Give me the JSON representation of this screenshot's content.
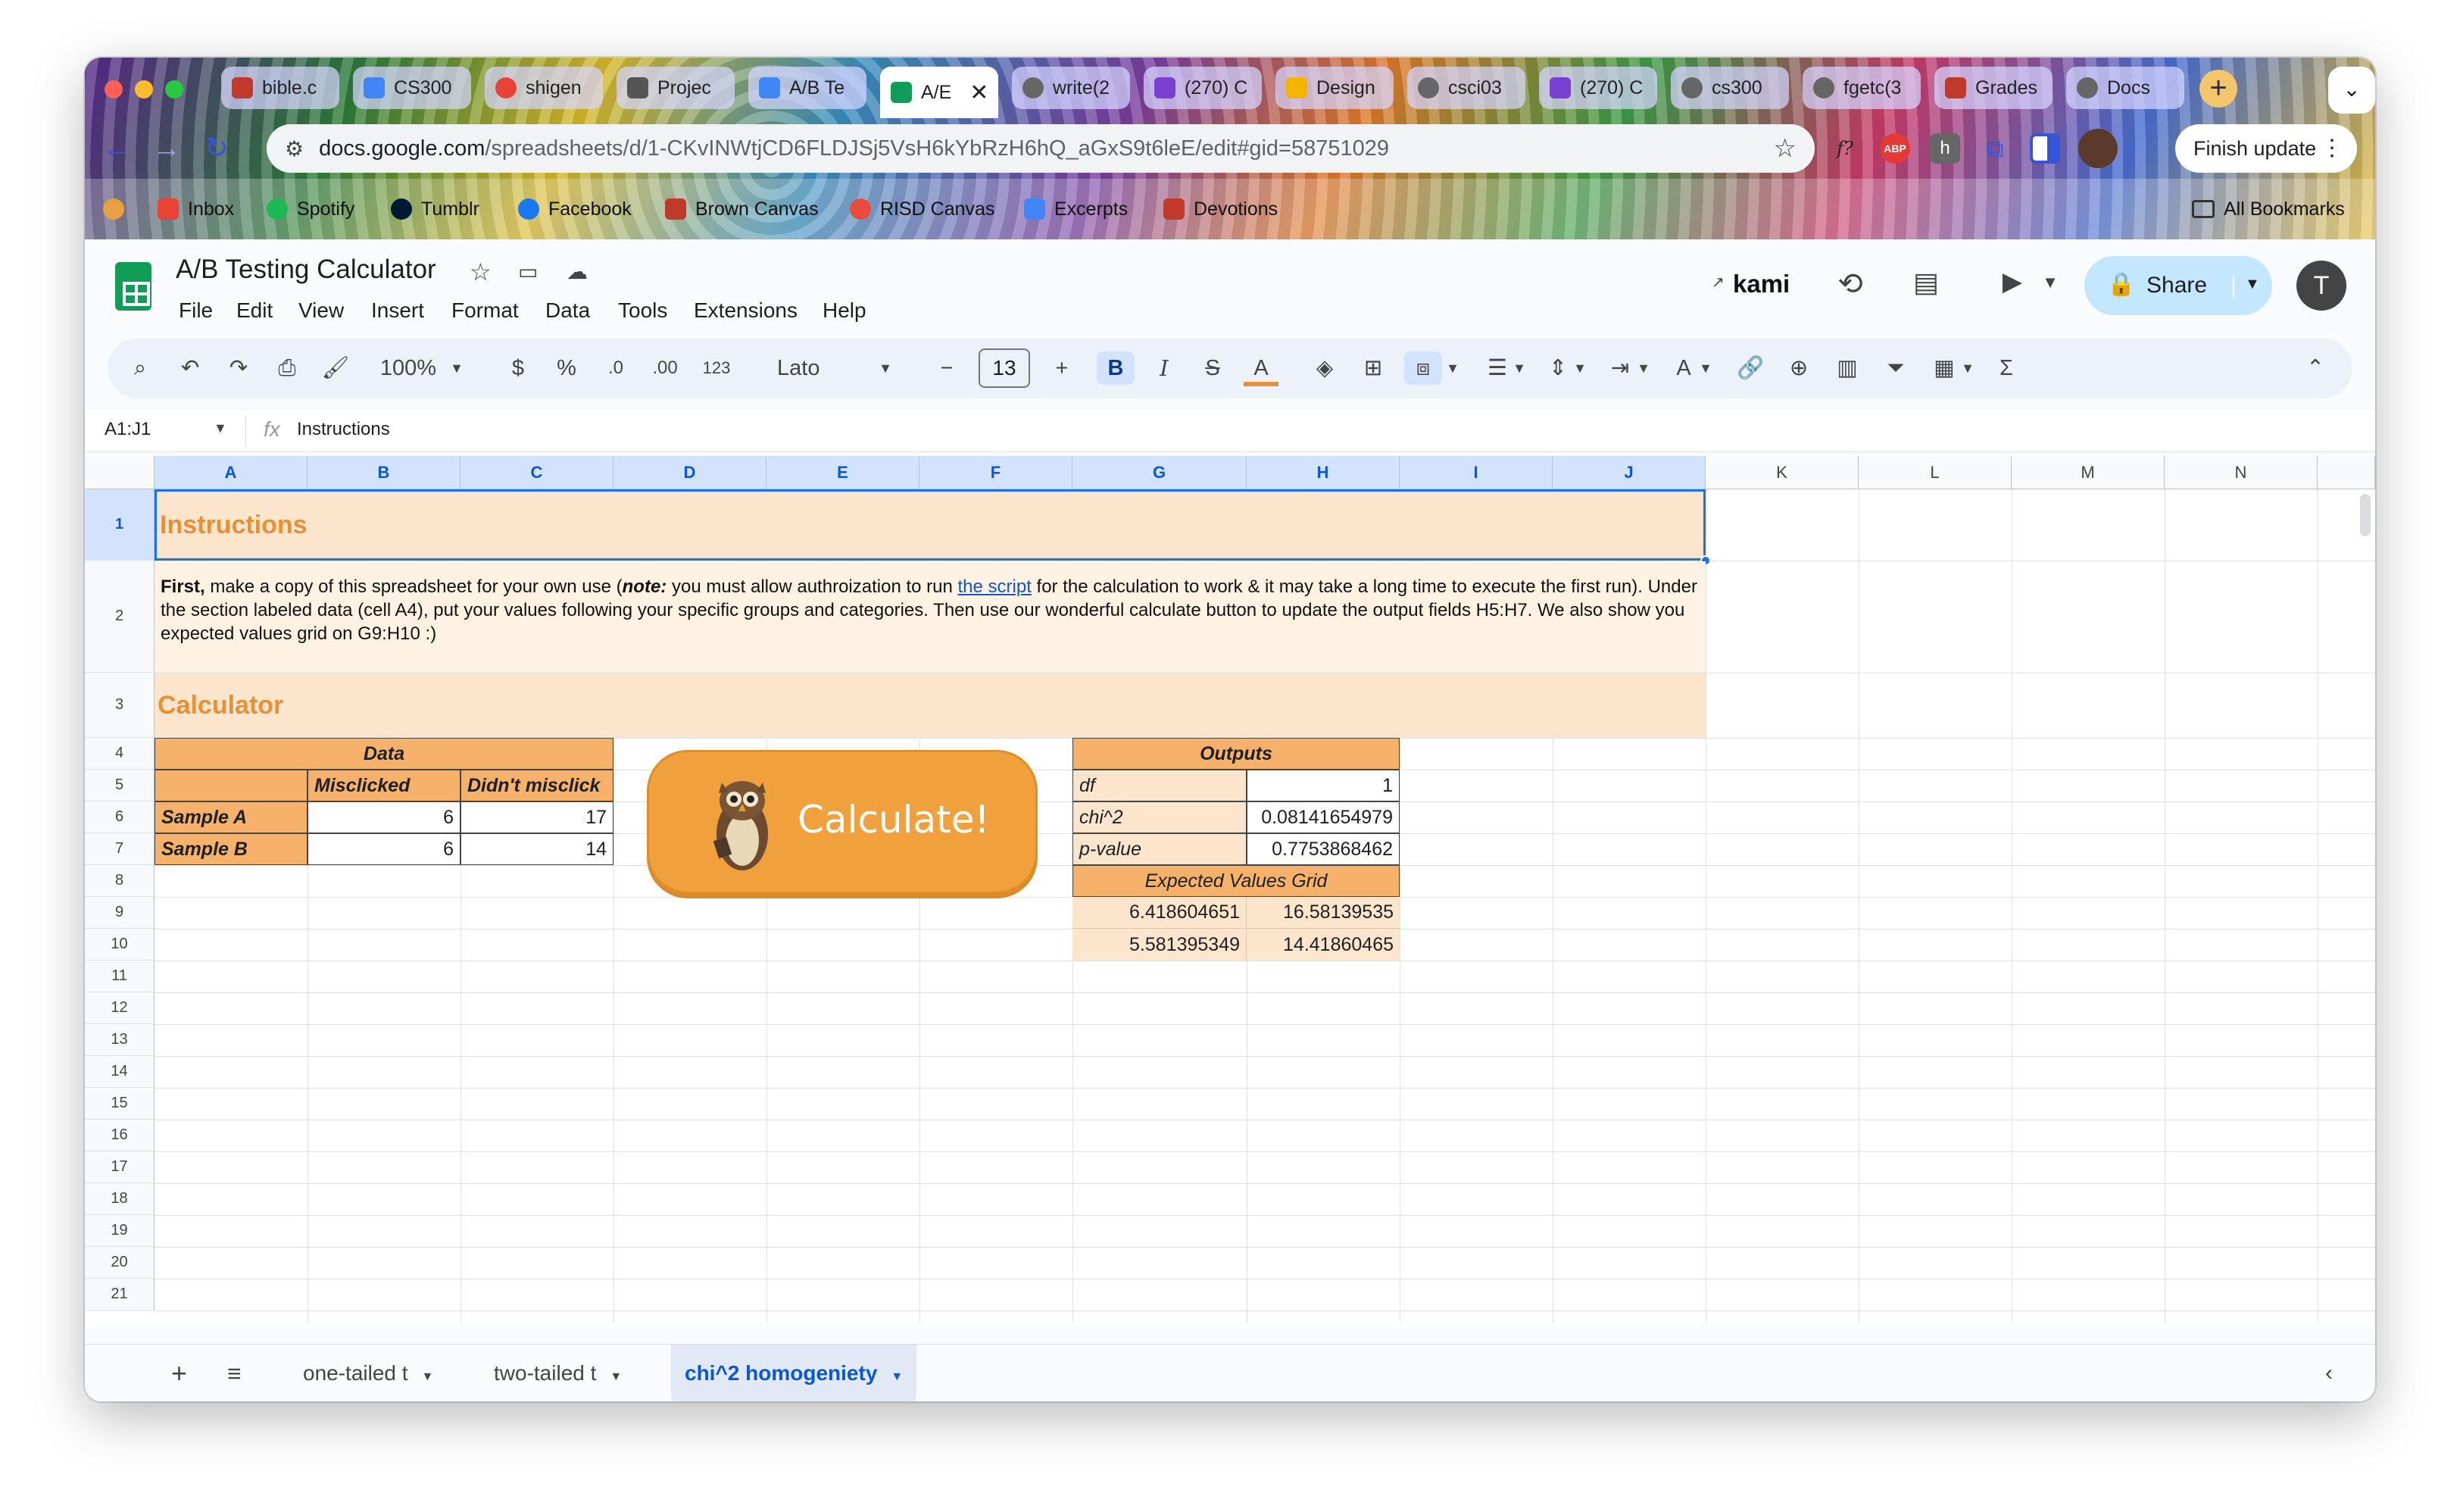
{
  "browser": {
    "tabs": [
      {
        "label": "bible.c",
        "color": "#c0392b"
      },
      {
        "label": "CS300",
        "color": "#4285f4"
      },
      {
        "label": "shigen",
        "color": "#ea4335"
      },
      {
        "label": "Projec",
        "color": "#555555"
      },
      {
        "label": "A/B Te",
        "color": "#4285f4"
      },
      {
        "label": "A/E",
        "color": "#0f9d58"
      },
      {
        "label": "write(2",
        "color": "#666666"
      },
      {
        "label": "(270) C",
        "color": "#7b3fd1"
      },
      {
        "label": "Design",
        "color": "#f4b400"
      },
      {
        "label": "csci03",
        "color": "#666666"
      },
      {
        "label": "(270) C",
        "color": "#7b3fd1"
      },
      {
        "label": "cs300",
        "color": "#666666"
      },
      {
        "label": "fgetc(3",
        "color": "#666666"
      },
      {
        "label": "Grades",
        "color": "#c0392b"
      },
      {
        "label": "Docs",
        "color": "#666666"
      }
    ],
    "new_tab": "+",
    "url_host": "docs.google.com",
    "url_path": "/spreadsheets/d/1-CKvINWtjCD6FLDJSj5VsH6kYbRzH6hQ_aGxS9t6leE/edit#gid=58751029",
    "finish_update": "Finish update",
    "extension_f": "f?",
    "extension_abp": "ABP",
    "bookmarks": [
      {
        "label": "Inbox",
        "color": "#ea4335"
      },
      {
        "label": "Spotify",
        "color": "#1db954"
      },
      {
        "label": "Tumblr",
        "color": "#001935"
      },
      {
        "label": "Facebook",
        "color": "#1877f2"
      },
      {
        "label": "Brown Canvas",
        "color": "#c0392b"
      },
      {
        "label": "RISD Canvas",
        "color": "#e74c3c"
      },
      {
        "label": "Excerpts",
        "color": "#4285f4"
      },
      {
        "label": "Devotions",
        "color": "#c0392b"
      }
    ],
    "all_bookmarks": "All Bookmarks"
  },
  "doc": {
    "title": "A/B Testing Calculator",
    "menus": [
      "File",
      "Edit",
      "View",
      "Insert",
      "Format",
      "Data",
      "Tools",
      "Extensions",
      "Help"
    ],
    "kami": "kami",
    "share": "Share",
    "avatar": "T"
  },
  "toolbar": {
    "zoom": "100%",
    "currency": "$",
    "percent": "%",
    "dec_decrease": ".0",
    "dec_increase": ".00",
    "number_format": "123",
    "font": "Lato",
    "font_size": "13",
    "bold": "B",
    "italic": "I",
    "strike": "S",
    "text_color": "A"
  },
  "formula_bar": {
    "name_box": "A1:J1",
    "fx": "fx",
    "value": "Instructions"
  },
  "sheet": {
    "columns": [
      "A",
      "B",
      "C",
      "D",
      "E",
      "F",
      "G",
      "H",
      "I",
      "J",
      "K",
      "L",
      "M",
      "N"
    ],
    "rows": [
      "1",
      "2",
      "3",
      "4",
      "5",
      "6",
      "7",
      "8",
      "9",
      "10",
      "11",
      "12",
      "13",
      "14",
      "15",
      "16",
      "17",
      "18",
      "19",
      "20",
      "21"
    ],
    "instructions_title": "Instructions",
    "instructions_first": "First,",
    "instructions_p1": " make a copy of this spreadsheet for your own use (",
    "instructions_note": "note:",
    "instructions_p2": " you must allow authroization to run ",
    "instructions_link": "the script",
    "instructions_p3": " for the calculation to work & it may take a long time to execute the first run). Under the section labeled data (cell A4), put your values following your specific groups and categories. Then use our wonderful calculate button to update the output fields H5:H7. We also show you expected values grid on G9:H10 :)",
    "calculator_title": "Calculator",
    "data_header": "Data",
    "col_misclicked": "Misclicked",
    "col_didnt": "Didn't misclick",
    "sample_a": "Sample A",
    "sample_b": "Sample B",
    "a_mis": "6",
    "a_didnt": "17",
    "b_mis": "6",
    "b_didnt": "14",
    "calc_button": "Calculate!",
    "outputs_header": "Outputs",
    "df_label": "df",
    "df_value": "1",
    "chi_label": "chi^2",
    "chi_value": "0.08141654979",
    "p_label": "p-value",
    "p_value": "0.7753868462",
    "expected_header": "Expected Values Grid",
    "e11": "6.418604651",
    "e12": "16.58139535",
    "e21": "5.581395349",
    "e22": "14.41860465"
  },
  "sheet_tabs": [
    "one-tailed t",
    "two-tailed t",
    "chi^2 homogeniety"
  ]
}
